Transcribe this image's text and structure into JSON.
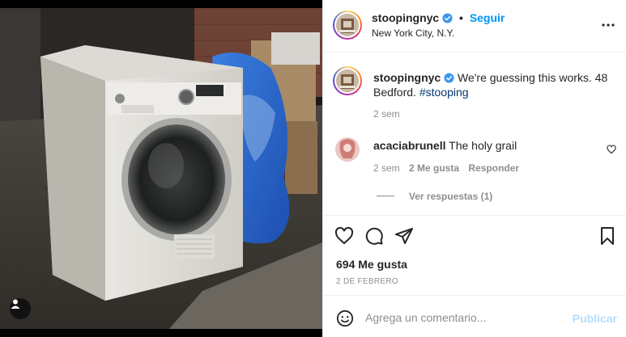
{
  "post": {
    "username": "stoopingnyc",
    "follow_label": "Seguir",
    "separator": "•",
    "location": "New York City, N.Y."
  },
  "caption": {
    "username": "stoopingnyc",
    "text": "We're guessing this works. 48 Bedford.",
    "hashtag": "#stooping",
    "age": "2 sem"
  },
  "comment": {
    "username": "acaciabrunell",
    "text": "The holy grail",
    "age": "2 sem",
    "likes": "2 Me gusta",
    "reply_label": "Responder",
    "view_replies": "Ver respuestas (1)"
  },
  "stats": {
    "likes": "694 Me gusta",
    "date": "2 DE FEBRERO"
  },
  "composer": {
    "placeholder": "Agrega un comentario...",
    "publish_label": "Publicar"
  },
  "icons": {
    "more": "more-options-icon",
    "like": "heart-icon",
    "comment": "comment-icon",
    "share": "share-icon",
    "save": "bookmark-icon",
    "emoji": "emoji-icon",
    "user_tag": "user-tag-icon",
    "verified": "verified-badge-icon"
  },
  "colors": {
    "accent": "#0095f6",
    "publish_disabled": "#b2dffc",
    "verified": "#3897f0",
    "text": "#262626",
    "muted": "#8e8e8e"
  }
}
